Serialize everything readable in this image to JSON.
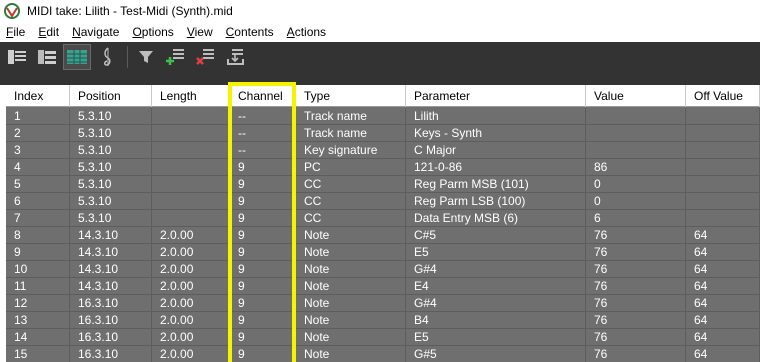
{
  "window": {
    "title": "MIDI take: Lilith - Test-Midi (Synth).mid"
  },
  "menu": [
    {
      "accel": "F",
      "rest": "ile"
    },
    {
      "accel": "E",
      "rest": "dit"
    },
    {
      "accel": "N",
      "rest": "avigate"
    },
    {
      "accel": "O",
      "rest": "ptions"
    },
    {
      "accel": "V",
      "rest": "iew"
    },
    {
      "accel": "C",
      "rest": "ontents"
    },
    {
      "accel": "A",
      "rest": "ctions"
    }
  ],
  "toolbar": {
    "buttons": [
      "piano-roll-view-icon",
      "named-notes-view-icon",
      "event-list-view-icon",
      "notation-view-icon",
      "filter-icon",
      "insert-event-icon",
      "delete-event-icon",
      "import-event-icon"
    ],
    "active_button": "event-list-view-icon"
  },
  "table": {
    "columns": [
      "Index",
      "Position",
      "Length",
      "Channel",
      "Type",
      "Parameter",
      "Value",
      "Off Value"
    ],
    "rows": [
      [
        "1",
        "5.3.10",
        "",
        "--",
        "Track name",
        "Lilith",
        "",
        ""
      ],
      [
        "2",
        "5.3.10",
        "",
        "--",
        "Track name",
        "Keys - Synth",
        "",
        ""
      ],
      [
        "3",
        "5.3.10",
        "",
        "--",
        "Key signature",
        "C Major",
        "",
        ""
      ],
      [
        "4",
        "5.3.10",
        "",
        "9",
        "PC",
        "121-0-86",
        "86",
        ""
      ],
      [
        "5",
        "5.3.10",
        "",
        "9",
        "CC",
        "Reg Parm MSB (101)",
        "0",
        ""
      ],
      [
        "6",
        "5.3.10",
        "",
        "9",
        "CC",
        "Reg Parm LSB (100)",
        "0",
        ""
      ],
      [
        "7",
        "5.3.10",
        "",
        "9",
        "CC",
        "Data Entry MSB (6)",
        "6",
        ""
      ],
      [
        "8",
        "14.3.10",
        "2.0.00",
        "9",
        "Note",
        "C#5",
        "76",
        "64"
      ],
      [
        "9",
        "14.3.10",
        "2.0.00",
        "9",
        "Note",
        "E5",
        "76",
        "64"
      ],
      [
        "10",
        "14.3.10",
        "2.0.00",
        "9",
        "Note",
        "G#4",
        "76",
        "64"
      ],
      [
        "11",
        "14.3.10",
        "2.0.00",
        "9",
        "Note",
        "E4",
        "76",
        "64"
      ],
      [
        "12",
        "16.3.10",
        "2.0.00",
        "9",
        "Note",
        "G#4",
        "76",
        "64"
      ],
      [
        "13",
        "16.3.10",
        "2.0.00",
        "9",
        "Note",
        "B4",
        "76",
        "64"
      ],
      [
        "14",
        "16.3.10",
        "2.0.00",
        "9",
        "Note",
        "E5",
        "76",
        "64"
      ],
      [
        "15",
        "16.3.10",
        "2.0.00",
        "9",
        "Note",
        "G#5",
        "76",
        "64"
      ]
    ]
  },
  "colors": {
    "toolbar_bg": "#333333",
    "row_bg": "#6f6f6f",
    "highlight": "#f4f400"
  }
}
